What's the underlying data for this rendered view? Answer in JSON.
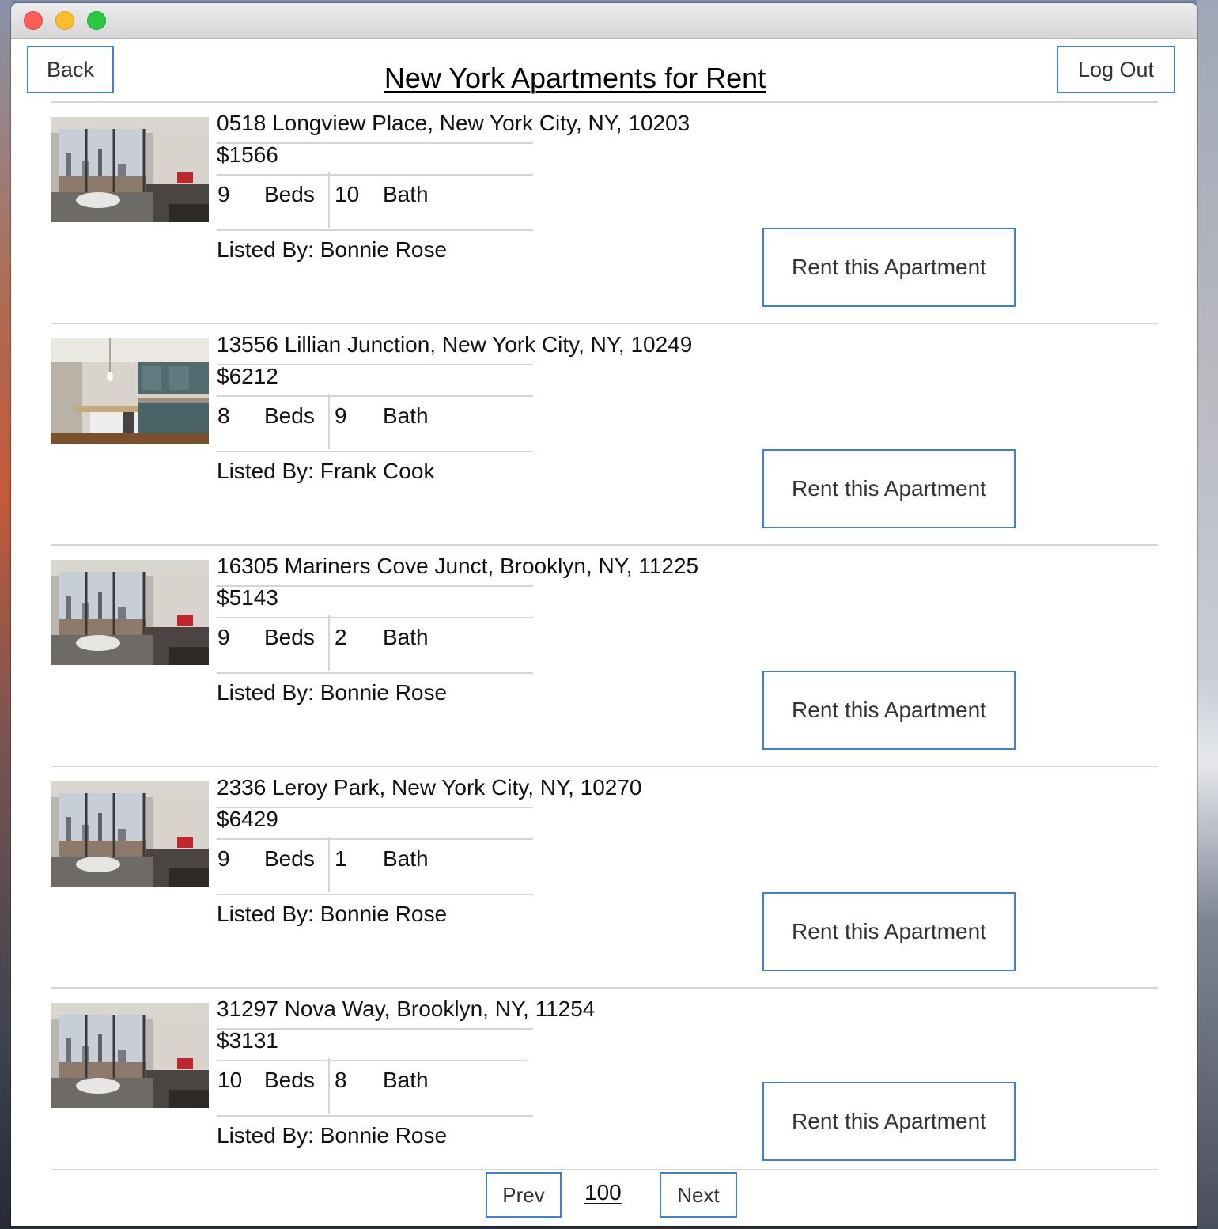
{
  "window": {
    "title": ""
  },
  "header": {
    "back_label": "Back",
    "title": "New York Apartments for Rent",
    "logout_label": "Log Out"
  },
  "listings": [
    {
      "address": "0518 Longview Place, New York City, NY, 10203",
      "price": "$1566",
      "beds": "9",
      "beds_label": "Beds",
      "baths": "10",
      "baths_label": "Bath",
      "listed_by": "Listed By: Bonnie Rose",
      "button_label": "Rent this Apartment",
      "photo": "living-room-photo"
    },
    {
      "address": "13556 Lillian Junction, New York City, NY, 10249",
      "price": "$6212",
      "beds": "8",
      "beds_label": "Beds",
      "baths": "9",
      "baths_label": "Bath",
      "listed_by": "Listed By: Frank Cook",
      "button_label": "Rent this Apartment",
      "photo": "kitchen-photo"
    },
    {
      "address": "16305 Mariners Cove Junct, Brooklyn, NY, 11225",
      "price": "$5143",
      "beds": "9",
      "beds_label": "Beds",
      "baths": "2",
      "baths_label": "Bath",
      "listed_by": "Listed By: Bonnie Rose",
      "button_label": "Rent this Apartment",
      "photo": "living-room-photo"
    },
    {
      "address": "2336 Leroy Park, New York City, NY, 10270",
      "price": "$6429",
      "beds": "9",
      "beds_label": "Beds",
      "baths": "1",
      "baths_label": "Bath",
      "listed_by": "Listed By: Bonnie Rose",
      "button_label": "Rent this Apartment",
      "photo": "living-room-photo"
    },
    {
      "address": "31297 Nova Way, Brooklyn, NY, 11254",
      "price": "$3131",
      "beds": "10",
      "beds_label": "Beds",
      "baths": "8",
      "baths_label": "Bath",
      "listed_by": "Listed By: Bonnie Rose",
      "button_label": "Rent this Apartment",
      "photo": "living-room-photo"
    }
  ],
  "pagination": {
    "prev_label": "Prev",
    "page": "100",
    "next_label": "Next"
  },
  "colors": {
    "accent": "#3d7fd9",
    "divider": "#d4d4d4"
  }
}
